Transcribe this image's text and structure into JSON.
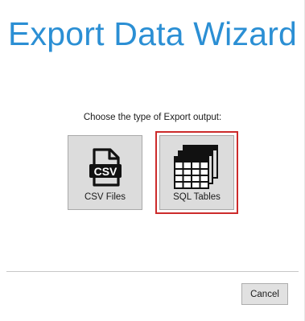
{
  "wizard": {
    "title": "Export Data Wizard",
    "prompt": "Choose the type of Export output:"
  },
  "options": [
    {
      "label": "CSV Files",
      "icon": "csv-file-icon",
      "selected": false
    },
    {
      "label": "SQL Tables",
      "icon": "sql-tables-icon",
      "selected": true
    }
  ],
  "footer": {
    "cancel_label": "Cancel"
  },
  "colors": {
    "title": "#2b8fd4",
    "selection": "#cc2b2b",
    "tile_background": "#dcdcdc"
  },
  "icons": {
    "csv_badge_text": "CSV"
  }
}
